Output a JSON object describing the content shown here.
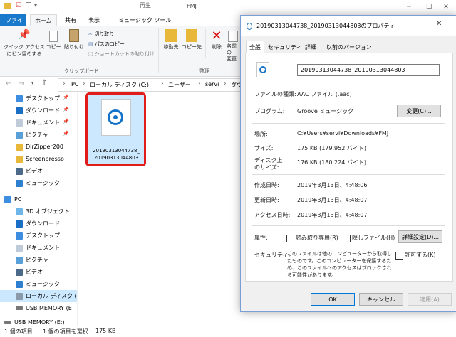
{
  "explorer": {
    "window_title": "FMJ",
    "context_group": "再生",
    "tabs": [
      "ファイル",
      "ホーム",
      "共有",
      "表示",
      "ミュージック ツール"
    ],
    "ribbon": {
      "pin_label": "クイック アクセス\nにピン留めする",
      "copy_label": "コピー",
      "paste_label": "貼り付け",
      "cut_label": "切り取り",
      "copy_path_label": "パスのコピー",
      "paste_shortcut_label": "ショートカットの貼り付け",
      "clipboard_group": "クリップボード",
      "move_label": "移動先",
      "copy_to_label": "コピー先",
      "delete_label": "削除",
      "rename_label": "名前の\n変更",
      "organize_group": "整理"
    },
    "address": [
      "PC",
      "ローカル ディスク (C:)",
      "ユーザー",
      "servi",
      "ダウンロード"
    ],
    "nav_items": [
      {
        "label": "デスクトップ",
        "pinned": true
      },
      {
        "label": "ダウンロード",
        "pinned": true
      },
      {
        "label": "ドキュメント",
        "pinned": true
      },
      {
        "label": "ピクチャ",
        "pinned": true
      },
      {
        "label": "DirZipper200",
        "pinned": false
      },
      {
        "label": "Screenpresso",
        "pinned": false
      },
      {
        "label": "ビデオ",
        "pinned": false
      },
      {
        "label": "ミュージック",
        "pinned": false
      },
      {
        "label": "PC",
        "pinned": false
      },
      {
        "label": "3D オブジェクト",
        "pinned": false
      },
      {
        "label": "ダウンロード",
        "pinned": false
      },
      {
        "label": "デスクトップ",
        "pinned": false
      },
      {
        "label": "ドキュメント",
        "pinned": false
      },
      {
        "label": "ピクチャ",
        "pinned": false
      },
      {
        "label": "ビデオ",
        "pinned": false
      },
      {
        "label": "ミュージック",
        "pinned": false
      },
      {
        "label": "ローカル ディスク (C",
        "pinned": false
      },
      {
        "label": "USB MEMORY (E",
        "pinned": false
      },
      {
        "label": "USB MEMORY (E:)",
        "pinned": false
      }
    ],
    "file": {
      "name_line1": "20190313044738_",
      "name_line2": "20190313044803"
    },
    "status": {
      "items": "1 個の項目",
      "selected": "1 個の項目を選択",
      "size": "175 KB"
    }
  },
  "dialog": {
    "title": "20190313044738_20190313044803のプロパティ",
    "tabs": [
      "全般",
      "セキュリティ",
      "詳細",
      "以前のバージョン"
    ],
    "filename": "20190313044738_20190313044803",
    "rows": {
      "type_label": "ファイルの種類:",
      "type_value": "AAC ファイル (.aac)",
      "program_label": "プログラム:",
      "program_value": "Groove ミュージック",
      "change_button": "変更(C)...",
      "location_label": "場所:",
      "location_value": "C:¥Users¥servi¥Downloads¥FMJ",
      "size_label": "サイズ:",
      "size_value": "175 KB (179,952 バイト)",
      "disk_label_1": "ディスク上",
      "disk_label_2": "のサイズ:",
      "disk_value": "176 KB (180,224 バイト)",
      "created_label": "作成日時:",
      "created_value": "2019年3月13日、4:48:06",
      "modified_label": "更新日時:",
      "modified_value": "2019年3月13日、4:48:07",
      "accessed_label": "アクセス日時:",
      "accessed_value": "2019年3月13日、4:48:07",
      "attr_label": "属性:",
      "readonly_label": "読み取り専用(R)",
      "hidden_label": "隠しファイル(H)",
      "advanced_button": "詳細設定(D)...",
      "security_label": "セキュリティ:",
      "security_text": "このファイルは他のコンピューターから取得したものです。このコンピューターを保護するため、このファイルへのアクセスはブロックされる可能性があります。",
      "allow_label": "許可する(K)"
    },
    "buttons": {
      "ok": "OK",
      "cancel": "キャンセル",
      "apply": "適用(A)"
    }
  }
}
